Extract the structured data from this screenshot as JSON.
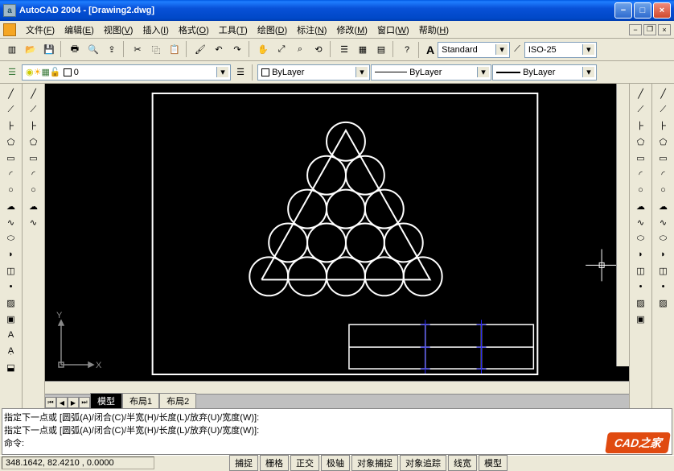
{
  "title": "AutoCAD 2004 - [Drawing2.dwg]",
  "appicon_letter": "a",
  "menus": [
    {
      "label": "文件",
      "key": "F"
    },
    {
      "label": "编辑",
      "key": "E"
    },
    {
      "label": "视图",
      "key": "V"
    },
    {
      "label": "插入",
      "key": "I"
    },
    {
      "label": "格式",
      "key": "O"
    },
    {
      "label": "工具",
      "key": "T"
    },
    {
      "label": "绘图",
      "key": "D"
    },
    {
      "label": "标注",
      "key": "N"
    },
    {
      "label": "修改",
      "key": "M"
    },
    {
      "label": "窗口",
      "key": "W"
    },
    {
      "label": "帮助",
      "key": "H"
    }
  ],
  "toolbar1_icons": [
    "new-icon",
    "open-icon",
    "save-icon",
    "plot-icon",
    "preview-icon",
    "publish-icon",
    "cut-icon",
    "copy-icon",
    "paste-icon",
    "matchprop-icon",
    "undo-icon",
    "redo-icon",
    "pan-icon",
    "zoom-realtime-icon",
    "zoom-window-icon",
    "zoom-previous-icon",
    "properties-icon",
    "designcenter-icon",
    "toolpalettes-icon",
    "help-icon"
  ],
  "textstyle": "Standard",
  "textstyle_icon": "A",
  "dimstyle": "ISO-25",
  "layer_toolbar": {
    "current": "0"
  },
  "color_combo": "ByLayer",
  "linetype_combo": "ByLayer",
  "lineweight_combo": "ByLayer",
  "left_tools": [
    "line-icon",
    "xline-icon",
    "pline-icon",
    "polygon-icon",
    "rectangle-icon",
    "arc-icon",
    "circle-icon",
    "revcloud-icon",
    "spline-icon",
    "ellipse-icon",
    "ellipsearc-icon",
    "block-icon",
    "point-icon",
    "hatch-icon",
    "region-icon",
    "text-icon",
    "addtext-icon",
    "surface-icon"
  ],
  "left_tools_b": [
    "constructionline-icon",
    "multiline-icon",
    "3dpoly-icon",
    "donut-icon",
    "arc3p-icon",
    "sketch-icon",
    "boundary-icon",
    "multitext-icon",
    "table-icon"
  ],
  "right_tools": [
    "erase-icon",
    "copy-icon",
    "mirror-icon",
    "offset-icon",
    "array-icon",
    "move-icon",
    "rotate-icon",
    "scale-icon",
    "stretch-icon",
    "trim-icon",
    "extend-icon",
    "break-icon",
    "chamfer-icon",
    "fillet-icon",
    "explode-icon"
  ],
  "tabs": {
    "model": "模型",
    "layout1": "布局1",
    "layout2": "布局2"
  },
  "cmd_history": [
    "指定下一点或 [圆弧(A)/闭合(C)/半宽(H)/长度(L)/放弃(U)/宽度(W)]:",
    "指定下一点或 [圆弧(A)/闭合(C)/半宽(H)/长度(L)/放弃(U)/宽度(W)]:"
  ],
  "cmd_prompt": "命令:",
  "coords": "348.1642, 82.4210 , 0.0000",
  "status_buttons": [
    "捕捉",
    "栅格",
    "正交",
    "极轴",
    "对象捕捉",
    "对象追踪",
    "线宽",
    "模型"
  ],
  "ucs_labels": {
    "x": "X",
    "y": "Y"
  },
  "watermark": "CAD之家",
  "chart_data": null
}
